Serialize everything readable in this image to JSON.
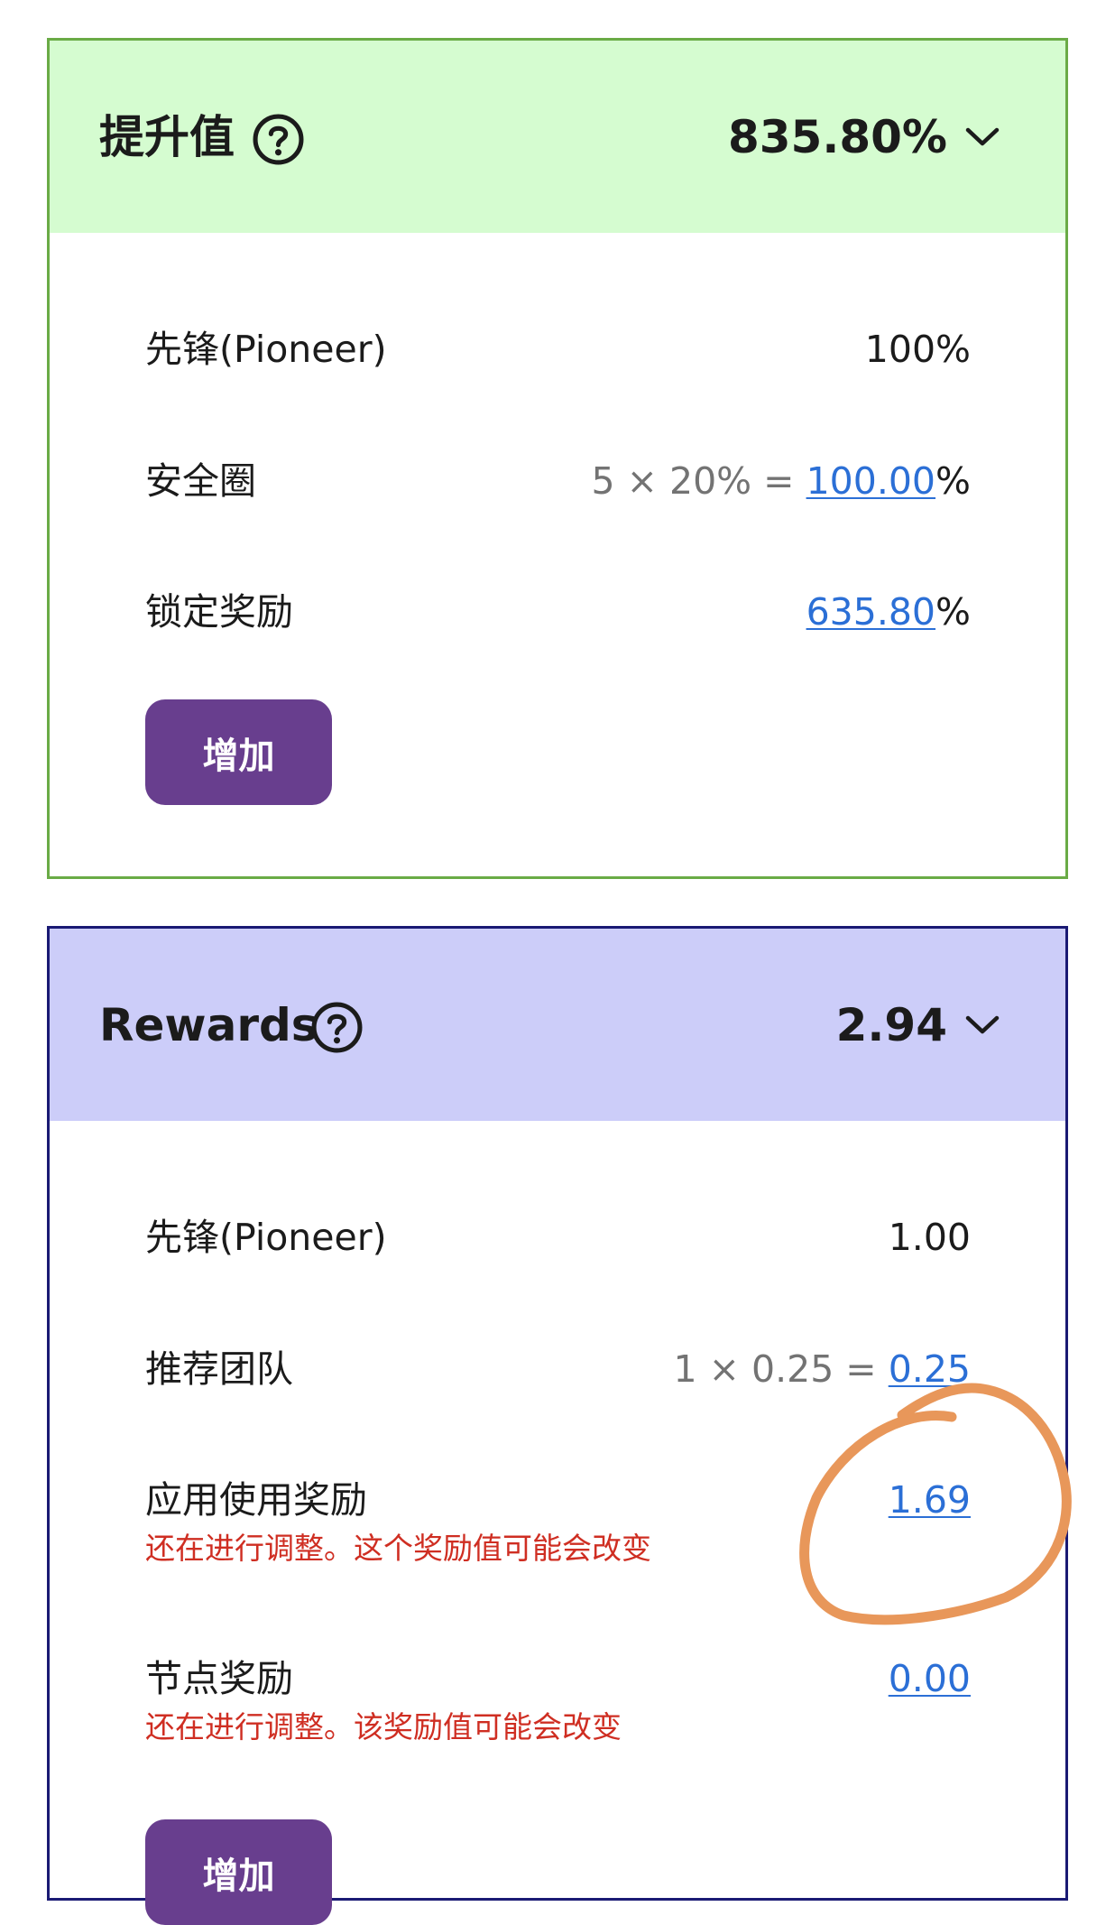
{
  "boost": {
    "title": "提升值",
    "value": "835.80%",
    "help_icon": "question-circle-icon",
    "expand_icon": "chevron-down-icon",
    "rows": {
      "pioneer": {
        "label": "先锋(Pioneer)",
        "value": "100%"
      },
      "security_circle": {
        "label": "安全圈",
        "formula": "5 × 20% = ",
        "link": "100.00",
        "suffix": "%"
      },
      "lockup": {
        "label": "锁定奖励",
        "link": "635.80",
        "suffix": "%"
      }
    },
    "add_button": "增加",
    "colors": {
      "header_bg": "#d5fcd0",
      "border": "#6aab46"
    }
  },
  "rewards": {
    "title": "Rewards",
    "value": "2.94",
    "help_icon": "question-circle-icon",
    "expand_icon": "chevron-down-icon",
    "rows": {
      "pioneer": {
        "label": "先锋(Pioneer)",
        "value": "1.00"
      },
      "referral_team": {
        "label": "推荐团队",
        "formula": "1 × 0.25 = ",
        "link": "0.25"
      },
      "app_usage": {
        "label": "应用使用奖励",
        "link": "1.69",
        "warning": "还在进行调整。这个奖励值可能会改变"
      },
      "node": {
        "label": "节点奖励",
        "link": "0.00",
        "warning": "还在进行调整。该奖励值可能会改变"
      }
    },
    "add_button": "增加",
    "colors": {
      "header_bg": "#cccdf9",
      "border": "#1a1a74"
    }
  },
  "colors": {
    "button": "#683e8e",
    "link": "#2b6fd6",
    "warning": "#cf2e22",
    "annotation": "#e8975a"
  }
}
